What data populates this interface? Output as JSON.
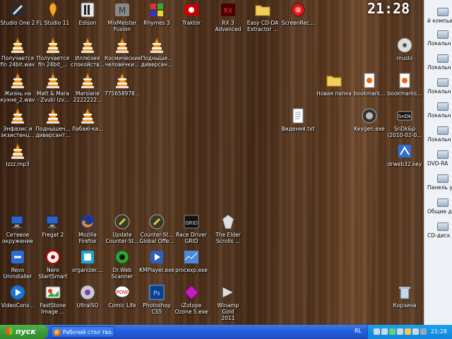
{
  "desktop_clock": "21:28",
  "icons": [
    {
      "label": "Studio One 2",
      "art": "studio"
    },
    {
      "label": "FL Studio 11",
      "art": "fl"
    },
    {
      "label": "Edison",
      "art": "edison"
    },
    {
      "label": "MixMeister\nFusion",
      "art": "mix"
    },
    {
      "label": "Rhymes 3",
      "art": "rhymes"
    },
    {
      "label": "Traktor",
      "art": "traktor"
    },
    {
      "label": "RX 3\nAdvanced",
      "art": "rx"
    },
    {
      "label": "Easy CD-DA\nExtractor ...",
      "art": "folder"
    },
    {
      "label": "ScreenRec...",
      "art": "rec"
    },
    {
      "label": "Получается\nfin 24bit.wav",
      "art": "vlc"
    },
    {
      "label": "Получается\nfin 24bit_...",
      "art": "vlc"
    },
    {
      "label": "Иллюзия\nспокойств...",
      "art": "vlc"
    },
    {
      "label": "Космические\nчеловечки...",
      "art": "vlc"
    },
    {
      "label": "Подныше...\nдиверсан...",
      "art": "vlc"
    },
    {
      "label": "muslo",
      "art": "disc"
    },
    {
      "label": "Жизнь на\nкухне_2.wav",
      "art": "vlc"
    },
    {
      "label": "Matt & Mara\n- Zvuki izv...",
      "art": "vlc"
    },
    {
      "label": "Marsiane\n2222222...",
      "art": "vlc"
    },
    {
      "label": "775658978...",
      "art": "vlc"
    },
    {
      "label": "Новая папка",
      "art": "folder"
    },
    {
      "label": "bookmark...",
      "art": "html"
    },
    {
      "label": "bookmarks...",
      "art": "html"
    },
    {
      "label": "Энфазис и\nэкзистенц...",
      "art": "vlc"
    },
    {
      "label": "Поднышеч...\nдиверсант...",
      "art": "vlc"
    },
    {
      "label": "Лабаю-ка...",
      "art": "vlc"
    },
    {
      "label": "Видения.txt",
      "art": "txt"
    },
    {
      "label": "Keygen.exe",
      "art": "keygen"
    },
    {
      "label": "SnDk&p\n(2010-02-0...",
      "art": "sndk"
    },
    {
      "label": "Izzz.mp3",
      "art": "vlc"
    },
    {
      "label": "drweb32.key",
      "art": "drkey"
    },
    {
      "label": "Сетевое\nокружение",
      "art": "net"
    },
    {
      "label": "Fregat 2",
      "art": "net"
    },
    {
      "label": "Mozilla\nFirefox",
      "art": "firefox"
    },
    {
      "label": "Update\nCounter-St...",
      "art": "cs"
    },
    {
      "label": "Counter-St...\nGlobal Offe...",
      "art": "cs"
    },
    {
      "label": "Race Driver\nGRID",
      "art": "grid"
    },
    {
      "label": "The Elder\nScrolls ...",
      "art": "elder"
    },
    {
      "label": "Revo\nUninstaller",
      "art": "revo"
    },
    {
      "label": "Nero\nStartSmart",
      "art": "nero"
    },
    {
      "label": "organizer....",
      "art": "org"
    },
    {
      "label": "Dr.Web\nScanner",
      "art": "drweb"
    },
    {
      "label": "KMPlayer.exe",
      "art": "kmp"
    },
    {
      "label": "procexp.exe",
      "art": "procexp"
    },
    {
      "label": "VideoConv...",
      "art": "vc"
    },
    {
      "label": "FastStone\nImage ...",
      "art": "fs"
    },
    {
      "label": "UltraISO",
      "art": "iso"
    },
    {
      "label": "Comic Life",
      "art": "comic"
    },
    {
      "label": "Photoshop\nCS5",
      "art": "ps"
    },
    {
      "label": "iZotope\nOzone 5.exe",
      "art": "ozone"
    },
    {
      "label": "Winamp Gold\n2011",
      "art": "winamp"
    },
    {
      "label": "Корзина",
      "art": "bin"
    }
  ],
  "sidebar": {
    "items": [
      {
        "label": "й компью"
      },
      {
        "label": "Локальн"
      },
      {
        "label": "Локальн"
      },
      {
        "label": "Локальн"
      },
      {
        "label": "Локальн"
      },
      {
        "label": "Локальн"
      },
      {
        "label": "DVD-RA"
      },
      {
        "label": "Панель у"
      },
      {
        "label": "Общие д"
      },
      {
        "label": "CD-диск"
      }
    ]
  },
  "taskbar": {
    "start_label": "пуск",
    "task_label": "Рабочий стол тво...",
    "lang": "RL",
    "tray_clock": "21:28"
  }
}
